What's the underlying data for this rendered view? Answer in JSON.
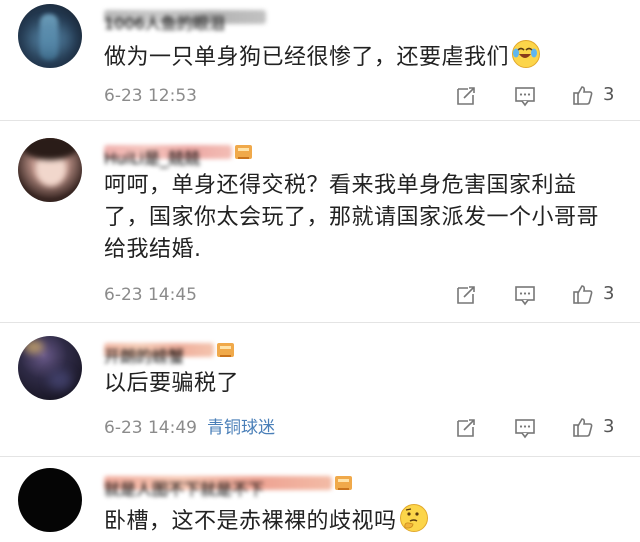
{
  "comments": [
    {
      "username": "1006人鱼的眼泪",
      "text_lines": [
        "做为一只单身狗已经很惨了，还要虐我们"
      ],
      "emoji": "crying-laughing-emoji",
      "time": "6-23 12:53",
      "tag": "",
      "likes": "3"
    },
    {
      "username": "HuiLi是_兢兢",
      "text_lines": [
        "呵呵，单身还得交税？看来我单身危害国家利益",
        "了，国家你太会玩了，那就请国家派发一个小哥哥",
        "给我结婚."
      ],
      "emoji": "",
      "time": "6-23 14:45",
      "tag": "",
      "likes": "3"
    },
    {
      "username": "开朗的螃蟹",
      "text_lines": [
        "以后要骗税了"
      ],
      "emoji": "",
      "time": "6-23 14:49",
      "tag": "青铜球迷",
      "likes": "3"
    },
    {
      "username": "就是人图不下就是不下",
      "text_lines": [
        "卧槽，这不是赤裸裸的歧视吗"
      ],
      "emoji": "thinking-emoji",
      "time": "",
      "tag": "",
      "likes": ""
    }
  ],
  "icons": {
    "repost": "repost-icon",
    "reply": "comment-icon",
    "like": "thumbs-up-icon",
    "verified": "vip-badge-icon"
  },
  "colors": {
    "text": "#222222",
    "meta": "#8b8b8b",
    "tag": "#4a7fb8",
    "divider": "#e4e4e4",
    "badge": "#f0a94a"
  }
}
